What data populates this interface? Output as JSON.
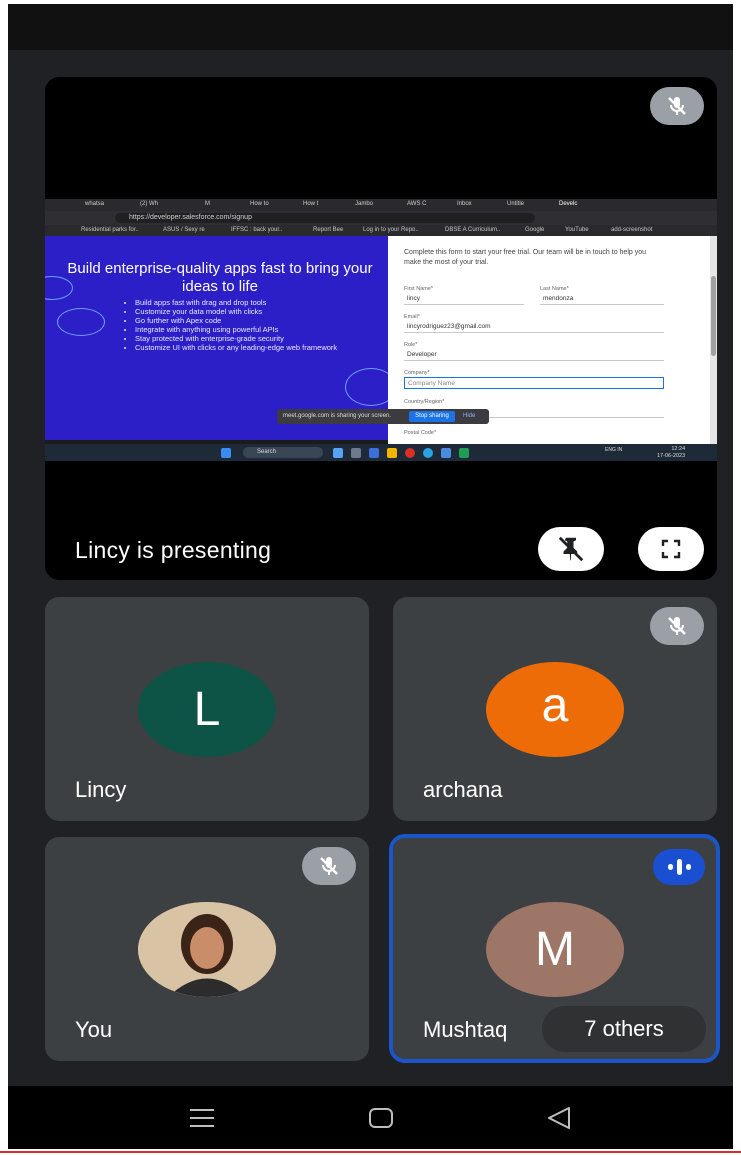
{
  "presentation": {
    "caption": "Lincy is presenting",
    "shared_screen": {
      "browser_tabs": [
        "whatsa",
        "(2) Wh",
        "M",
        "How to",
        "How t",
        "Jambo",
        "AWS C",
        "Inbox",
        "Untitle",
        "Develc"
      ],
      "url": "https://developer.salesforce.com/signup",
      "bookmarks": [
        "Residential parks for..",
        "ASUS / Sexy re",
        "IFFSC : back your..",
        "Report Bee",
        "Log in to your Repo..",
        "DBSE A Curriculum..",
        "Google",
        "YouTube",
        "add-screenshot"
      ],
      "hero_title": "Build enterprise-quality apps fast to bring your ideas to life",
      "features": [
        "Build apps fast with drag and drop tools",
        "Customize your data model with clicks",
        "Go further with Apex code",
        "Integrate with anything using powerful APIs",
        "Stay protected with enterprise-grade security",
        "Customize UI with clicks or any leading-edge web framework"
      ],
      "form": {
        "intro": "Complete this form to start your free trial. Our team will be in touch to help you make the most of your trial.",
        "first_name_label": "First Name*",
        "first_name_value": "lincy",
        "last_name_label": "Last Name*",
        "last_name_value": "mendonza",
        "email_label": "Email*",
        "email_value": "lincyrodriguez23@gmail.com",
        "role_label": "Role*",
        "role_value": "Developer",
        "company_label": "Company*",
        "company_placeholder": "Company Name",
        "country_label": "Country/Region*",
        "postal_label": "Postal Code*"
      },
      "share_notice": "meet.google.com is sharing your screen.",
      "stop_sharing": "Stop sharing",
      "hide": "Hide",
      "taskbar_search": "Search",
      "tray_lang": "ENG IN",
      "clock_time": "12:24",
      "clock_date": "17-06-2023"
    }
  },
  "participants": [
    {
      "name": "Lincy",
      "initial": "L",
      "avatar_color": "#0d5446",
      "muted": false
    },
    {
      "name": "archana",
      "initial": "a",
      "avatar_color": "#ee6c07",
      "muted": true
    },
    {
      "name": "You",
      "initial": "",
      "avatar_color": "#c9a27e",
      "muted": true
    },
    {
      "name": "Mushtaq",
      "initial": "M",
      "avatar_color": "#9e7668",
      "muted": false,
      "speaking": true
    }
  ],
  "others_label": "7 others",
  "icons": {
    "muted": "mic-off-icon",
    "unpin": "unpin-icon",
    "fullscreen": "fullscreen-icon",
    "speaking": "audio-level-icon",
    "nav_menu": "recent-apps-icon",
    "nav_home": "home-icon",
    "nav_back": "back-icon"
  },
  "colors": {
    "background": "#202124",
    "tile": "#3c4043",
    "active_border": "#1a56c9",
    "speaking_badge": "#1a4fd1"
  }
}
